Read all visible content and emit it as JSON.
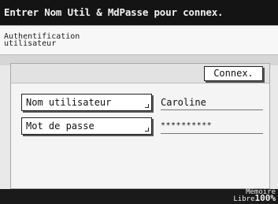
{
  "header": {
    "title": "Entrer Nom Util & MdPasse pour connex."
  },
  "subheader": {
    "label": "Authentification\nutilisateur"
  },
  "panel": {
    "connect_button_label": "Connex."
  },
  "fields": {
    "username": {
      "button_label": "Nom utilisateur",
      "value": "Caroline"
    },
    "password": {
      "button_label": "Mot de passe",
      "value": "**********"
    }
  },
  "status": {
    "memory_label": "Mémoire\nLibre",
    "memory_value": "100%"
  }
}
